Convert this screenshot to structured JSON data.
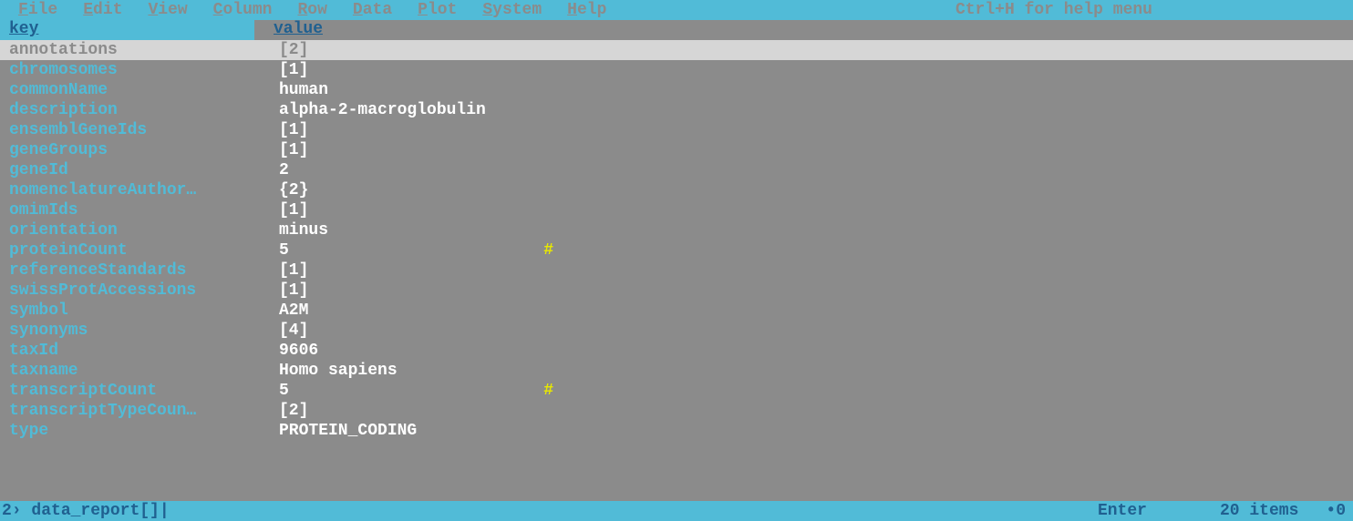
{
  "menu": {
    "items": [
      {
        "label": "File",
        "key": "F"
      },
      {
        "label": "Edit",
        "key": "E"
      },
      {
        "label": "View",
        "key": "V"
      },
      {
        "label": "Column",
        "key": "C"
      },
      {
        "label": "Row",
        "key": "R"
      },
      {
        "label": "Data",
        "key": "D"
      },
      {
        "label": "Plot",
        "key": "P"
      },
      {
        "label": "System",
        "key": "S"
      },
      {
        "label": "Help",
        "key": "H"
      }
    ],
    "helpHint": "Ctrl+H for help menu"
  },
  "columns": {
    "key": "key",
    "value": "value"
  },
  "rows": [
    {
      "key": "annotations",
      "value": "[2]",
      "selected": true,
      "marker": ""
    },
    {
      "key": "chromosomes",
      "value": "[1]",
      "selected": false,
      "marker": ""
    },
    {
      "key": "commonName",
      "value": "human",
      "selected": false,
      "marker": ""
    },
    {
      "key": "description",
      "value": "alpha-2-macroglobulin",
      "selected": false,
      "marker": ""
    },
    {
      "key": "ensemblGeneIds",
      "value": "[1]",
      "selected": false,
      "marker": ""
    },
    {
      "key": "geneGroups",
      "value": "[1]",
      "selected": false,
      "marker": ""
    },
    {
      "key": "geneId",
      "value": "2",
      "selected": false,
      "marker": ""
    },
    {
      "key": "nomenclatureAuthor…",
      "value": "{2}",
      "selected": false,
      "marker": ""
    },
    {
      "key": "omimIds",
      "value": "[1]",
      "selected": false,
      "marker": ""
    },
    {
      "key": "orientation",
      "value": "minus",
      "selected": false,
      "marker": ""
    },
    {
      "key": "proteinCount",
      "value": "5",
      "selected": false,
      "marker": "#"
    },
    {
      "key": "referenceStandards",
      "value": "[1]",
      "selected": false,
      "marker": ""
    },
    {
      "key": "swissProtAccessions",
      "value": "[1]",
      "selected": false,
      "marker": ""
    },
    {
      "key": "symbol",
      "value": "A2M",
      "selected": false,
      "marker": ""
    },
    {
      "key": "synonyms",
      "value": "[4]",
      "selected": false,
      "marker": ""
    },
    {
      "key": "taxId",
      "value": "9606",
      "selected": false,
      "marker": ""
    },
    {
      "key": "taxname",
      "value": "Homo sapiens",
      "selected": false,
      "marker": ""
    },
    {
      "key": "transcriptCount",
      "value": "5",
      "selected": false,
      "marker": "#"
    },
    {
      "key": "transcriptTypeCoun…",
      "value": "[2]",
      "selected": false,
      "marker": ""
    },
    {
      "key": "type",
      "value": "PROTEIN_CODING",
      "selected": false,
      "marker": ""
    }
  ],
  "status": {
    "level": "2›",
    "command": "data_report[]",
    "cursor": "|",
    "keyHint": "Enter",
    "itemCount": "20 items",
    "selCount": "•0"
  }
}
